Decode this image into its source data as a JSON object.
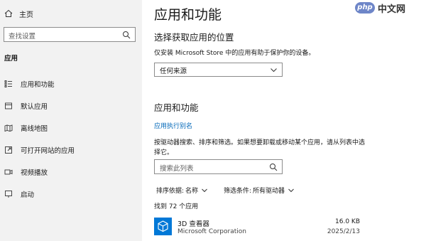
{
  "sidebar": {
    "home_label": "主页",
    "search_placeholder": "查找设置",
    "section_label": "应用",
    "items": [
      {
        "label": "应用和功能",
        "icon": "apps-features-icon"
      },
      {
        "label": "默认应用",
        "icon": "default-apps-icon"
      },
      {
        "label": "离线地图",
        "icon": "offline-maps-icon"
      },
      {
        "label": "可打开网站的应用",
        "icon": "apps-for-websites-icon"
      },
      {
        "label": "视频播放",
        "icon": "video-playback-icon"
      },
      {
        "label": "启动",
        "icon": "startup-icon"
      }
    ]
  },
  "main": {
    "title": "应用和功能",
    "location_heading": "选择获取应用的位置",
    "location_desc": "仅安装 Microsoft Store 中的应用有助于保护你的设备。",
    "location_dropdown_value": "任何来源",
    "apps_heading": "应用和功能",
    "alias_link": "应用执行别名",
    "apps_desc": "按驱动器搜索、排序和筛选。如果想要卸载或移动某个应用，请从列表中选择它。",
    "filter_placeholder": "搜索此列表",
    "sort_label": "排序依据:",
    "sort_value": "名称",
    "filter_label": "筛选条件:",
    "filter_value": "所有驱动器",
    "count_text": "找到 72 个应用",
    "apps": [
      {
        "name": "3D 查看器",
        "publisher": "Microsoft Corporation",
        "size": "16.0 KB",
        "date": "2025/2/13"
      }
    ]
  },
  "brand": {
    "badge": "php",
    "text": "中文网"
  },
  "colors": {
    "sidebar_bg": "#f2f2f2",
    "link": "#0067b8",
    "app_icon": "#0078d7"
  }
}
